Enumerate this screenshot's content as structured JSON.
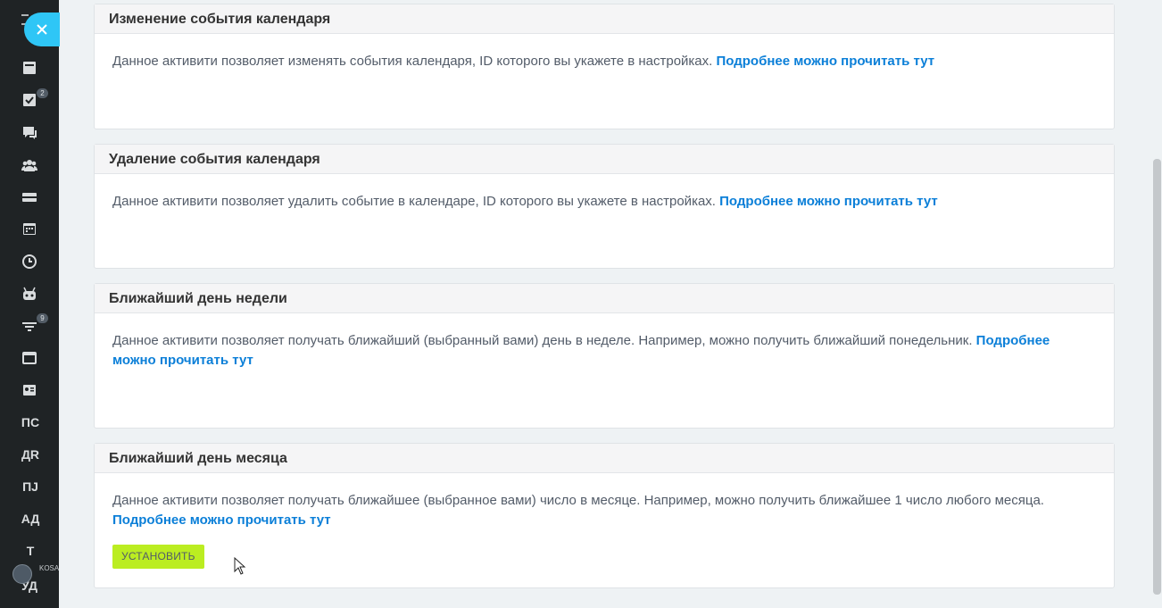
{
  "sidebar": {
    "badges": {
      "tasks": "2",
      "filter": "9"
    },
    "text_items": [
      "ПС",
      "ДR",
      "ПJ",
      "АД",
      "Т"
    ],
    "footer_text": "KOSA ВСЁ П",
    "footer_under": "УД"
  },
  "cards": [
    {
      "title": "Изменение события календаря",
      "description": "Данное активити позволяет изменять события календаря, ID которого вы укажете в настройках. ",
      "link": "Подробнее можно прочитать тут"
    },
    {
      "title": "Удаление события календаря",
      "description": "Данное активити позволяет удалить событие в календаре, ID которого вы укажете в настройках. ",
      "link": "Подробнее можно прочитать тут"
    },
    {
      "title": "Ближайший день недели",
      "description": "Данное активити позволяет получать ближайший (выбранный вами) день в неделе. Например, можно получить ближайший понедельник. ",
      "link": "Подробнее можно прочитать тут"
    },
    {
      "title": "Ближайший день месяца",
      "description": "Данное активити позволяет получать ближайшее (выбранное вами) число в месяце. Например, можно получить ближайшее 1 число любого месяца. ",
      "link": "Подробнее можно прочитать тут",
      "button": "УСТАНОВИТЬ"
    }
  ],
  "colors": {
    "accent": "#2fc6f6",
    "link": "#0b7fd8",
    "install": "#bbed21",
    "sidebar": "#1f2325"
  }
}
